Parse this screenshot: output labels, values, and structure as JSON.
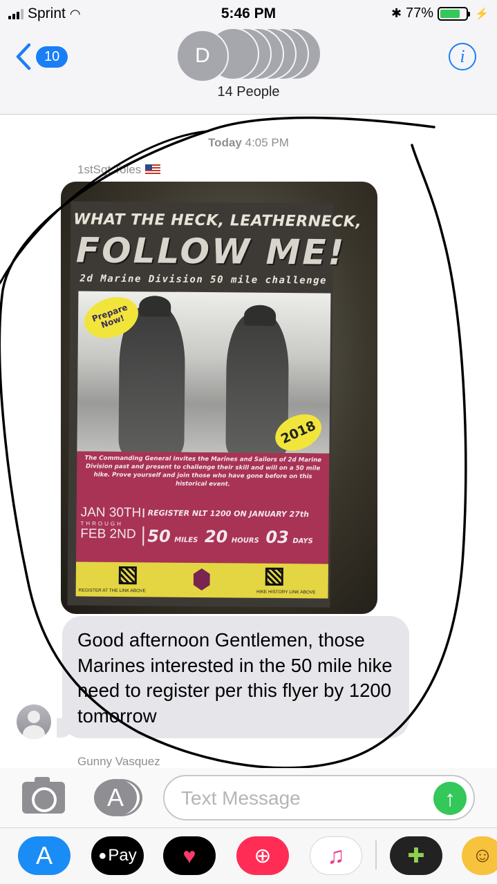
{
  "status_bar": {
    "carrier": "Sprint",
    "time": "5:46 PM",
    "battery_percent": "77%",
    "battery_level": 0.77
  },
  "nav": {
    "back_count": "10",
    "avatar_initial": "D",
    "group_label": "14 People",
    "info_glyph": "i"
  },
  "conversation": {
    "timestamp_day": "Today",
    "timestamp_time": "4:05 PM",
    "sender1": "1stSgt Toles",
    "flyer": {
      "line1": "WHAT THE HECK, LEATHERNECK,",
      "line2": "FOLLOW ME!",
      "line3": "2d Marine Division 50 mile challenge",
      "prepare_1": "Prepare",
      "prepare_2": "Now!",
      "year": "2018",
      "invite": "The Commanding General invites the Marines and Sailors of 2d Marine Division past and present to challenge their skill and will on a 50 mile hike. Prove yourself and join those who have gone before on this historical event.",
      "date_start": "JAN 30TH",
      "through": "THROUGH",
      "date_end": "FEB 2ND",
      "register": "REGISTER NLT 1200 ON JANUARY 27th",
      "miles_value": "50",
      "miles_unit": "MILES",
      "hours_value": "20",
      "hours_unit": "HOURS",
      "days_value": "03",
      "days_unit": "DAYS",
      "footer_left": "REGISTER AT THE LINK ABOVE",
      "footer_right": "HIKE HISTORY LINK ABOVE"
    },
    "message_text": "Good afternoon Gentlemen, those Marines interested in the 50 mile hike need to register per this flyer by 1200 tomorrow",
    "sender2": "Gunny Vasquez"
  },
  "input_bar": {
    "placeholder": "Text Message"
  },
  "app_drawer": {
    "pay_label": "Pay",
    "apps": [
      "app-store",
      "apple-pay",
      "digital-touch",
      "images-search",
      "music",
      "game",
      "character-stickers"
    ]
  }
}
